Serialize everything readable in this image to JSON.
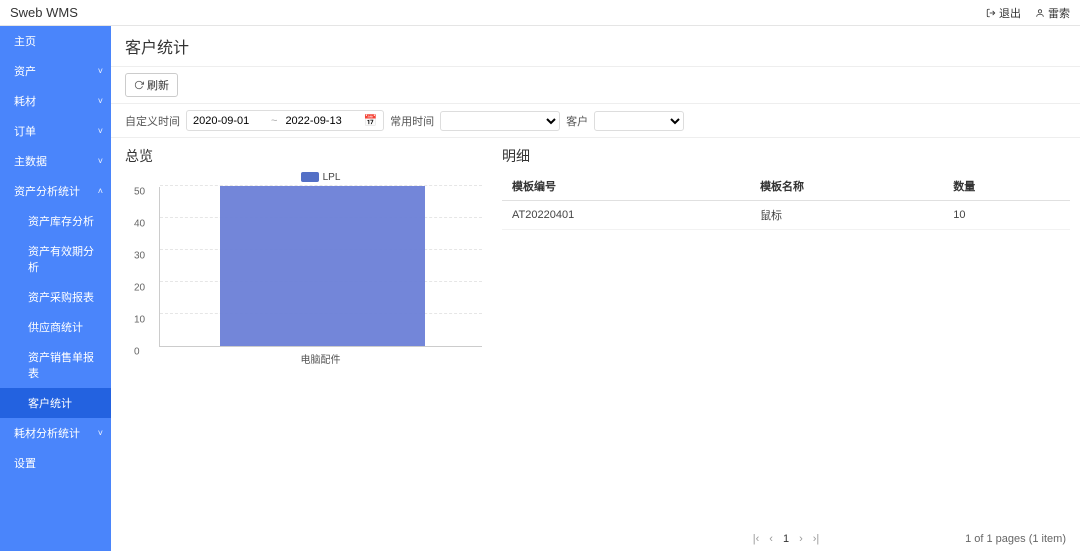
{
  "brand": "Sweb WMS",
  "top": {
    "logout": "退出",
    "user": "雷索"
  },
  "sidebar": {
    "items": [
      {
        "label": "主页",
        "expand": null
      },
      {
        "label": "资产",
        "expand": "down"
      },
      {
        "label": "耗材",
        "expand": "down"
      },
      {
        "label": "订单",
        "expand": "down"
      },
      {
        "label": "主数据",
        "expand": "down"
      },
      {
        "label": "资产分析统计",
        "expand": "up"
      },
      {
        "label": "资产库存分析",
        "sub": true
      },
      {
        "label": "资产有效期分析",
        "sub": true
      },
      {
        "label": "资产采购报表",
        "sub": true
      },
      {
        "label": "供应商统计",
        "sub": true
      },
      {
        "label": "资产销售单报表",
        "sub": true
      },
      {
        "label": "客户统计",
        "sub": true,
        "active": true
      },
      {
        "label": "耗材分析统计",
        "expand": "down"
      },
      {
        "label": "设置"
      }
    ]
  },
  "page": {
    "title": "客户统计"
  },
  "toolbar": {
    "refresh": "刷新"
  },
  "filter": {
    "custom_time_label": "自定义时间",
    "start_date": "2020-09-01",
    "end_date": "2022-09-13",
    "common_time_label": "常用时间",
    "common_time_value": "",
    "customer_label": "客户",
    "customer_value": ""
  },
  "overview": {
    "title": "总览"
  },
  "detail": {
    "title": "明细",
    "columns": [
      "模板编号",
      "模板名称",
      "数量"
    ],
    "rows": [
      {
        "code": "AT20220401",
        "name": "鼠标",
        "qty": "10"
      }
    ],
    "page_text": "1",
    "page_info": "1 of 1 pages (1 item)"
  },
  "chart_data": {
    "type": "bar",
    "title": "",
    "legend": [
      "LPL"
    ],
    "categories": [
      "电脑配件"
    ],
    "series": [
      {
        "name": "LPL",
        "values": [
          50
        ],
        "color": "#6b7fd7"
      }
    ],
    "ylim": [
      0,
      50
    ],
    "yticks": [
      0,
      10,
      20,
      30,
      40,
      50
    ],
    "xlabel": "",
    "ylabel": ""
  }
}
